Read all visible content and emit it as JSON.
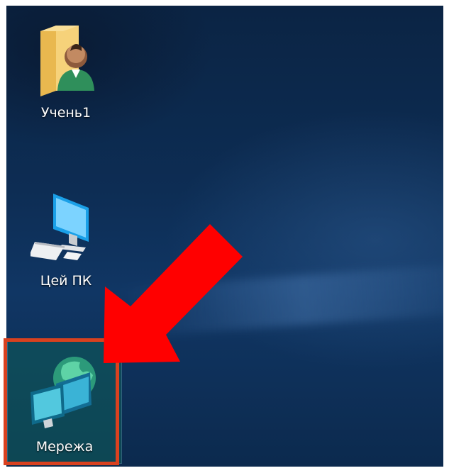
{
  "desktop": {
    "icons": [
      {
        "label": "Учень1",
        "icon": "user-folder-icon"
      },
      {
        "label": "Цей ПК",
        "icon": "computer-icon"
      },
      {
        "label": "Мережа",
        "icon": "network-icon",
        "selected": true
      }
    ]
  },
  "annotation": {
    "arrow_color": "#ff0000",
    "highlight_color": "#d9411f"
  }
}
